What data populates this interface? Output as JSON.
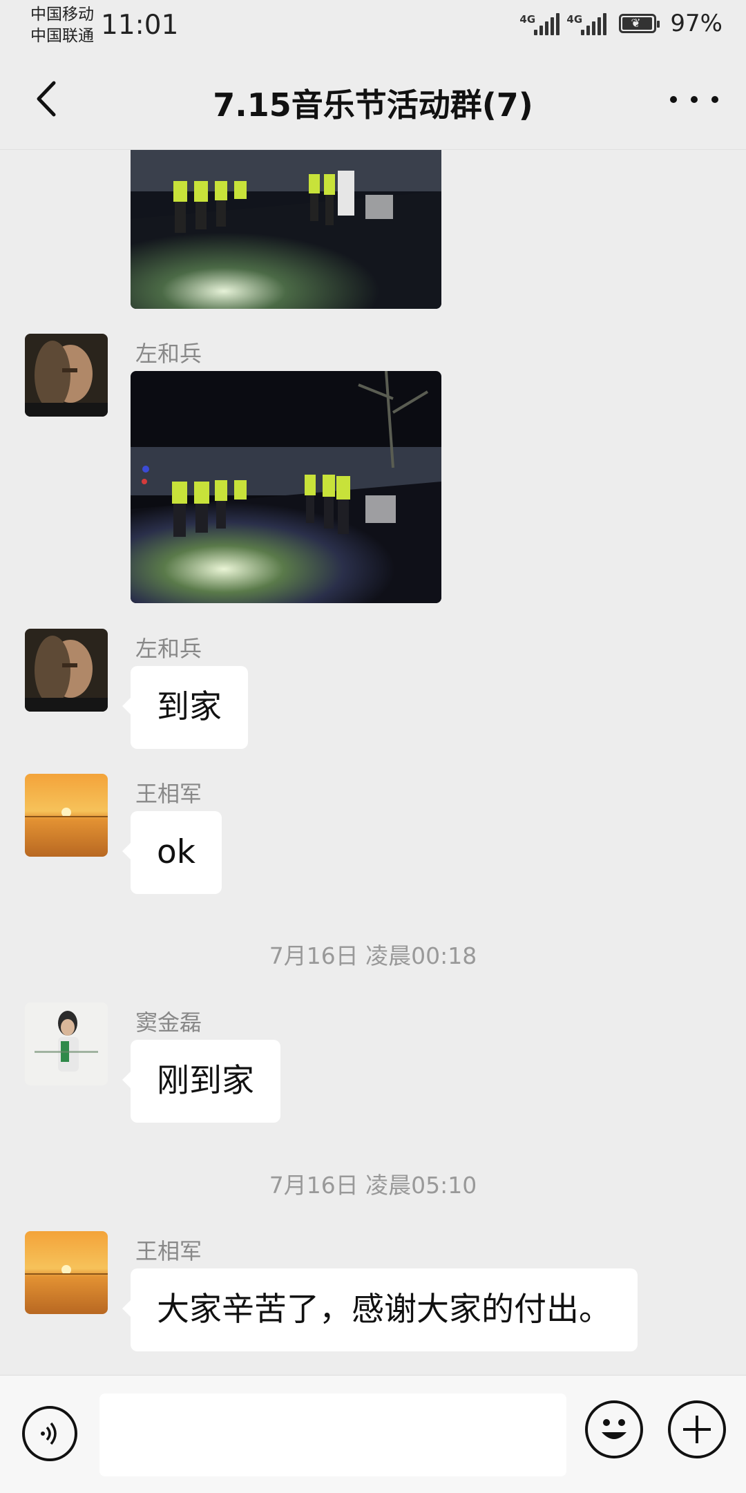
{
  "status_bar": {
    "carrier_1": "中国移动",
    "carrier_2": "中国联通",
    "time": "11:01",
    "signal_1_tag": "4G",
    "signal_2_tag": "4G",
    "battery_percent": "97%",
    "battery_level": 0.97
  },
  "header": {
    "title": "7.15音乐节活动群(7)",
    "back_icon": "chevron-left-icon",
    "more_icon": "more-horizontal-icon"
  },
  "messages": [
    {
      "type": "image",
      "sender": "",
      "content": "night outdoor group photo (partially scrolled)"
    },
    {
      "type": "image",
      "sender": "左和兵",
      "content": "night outdoor group photo"
    },
    {
      "type": "text",
      "sender": "左和兵",
      "text": "到家"
    },
    {
      "type": "text",
      "sender": "王相军",
      "text": "ok"
    },
    {
      "type": "time",
      "text": "7月16日 凌晨00:18"
    },
    {
      "type": "text",
      "sender": "窦金磊",
      "text": "刚到家"
    },
    {
      "type": "time",
      "text": "7月16日 凌晨05:10"
    },
    {
      "type": "text",
      "sender": "王相军",
      "text": "大家辛苦了，感谢大家的付出。"
    }
  ],
  "input_bar": {
    "voice_icon": "voice-icon",
    "emoji_icon": "emoji-icon",
    "plus_icon": "plus-circle-icon",
    "input_value": ""
  },
  "colors": {
    "background": "#ededed",
    "bubble": "#ffffff",
    "sender_text": "#888888",
    "timestamp_text": "#999999"
  }
}
